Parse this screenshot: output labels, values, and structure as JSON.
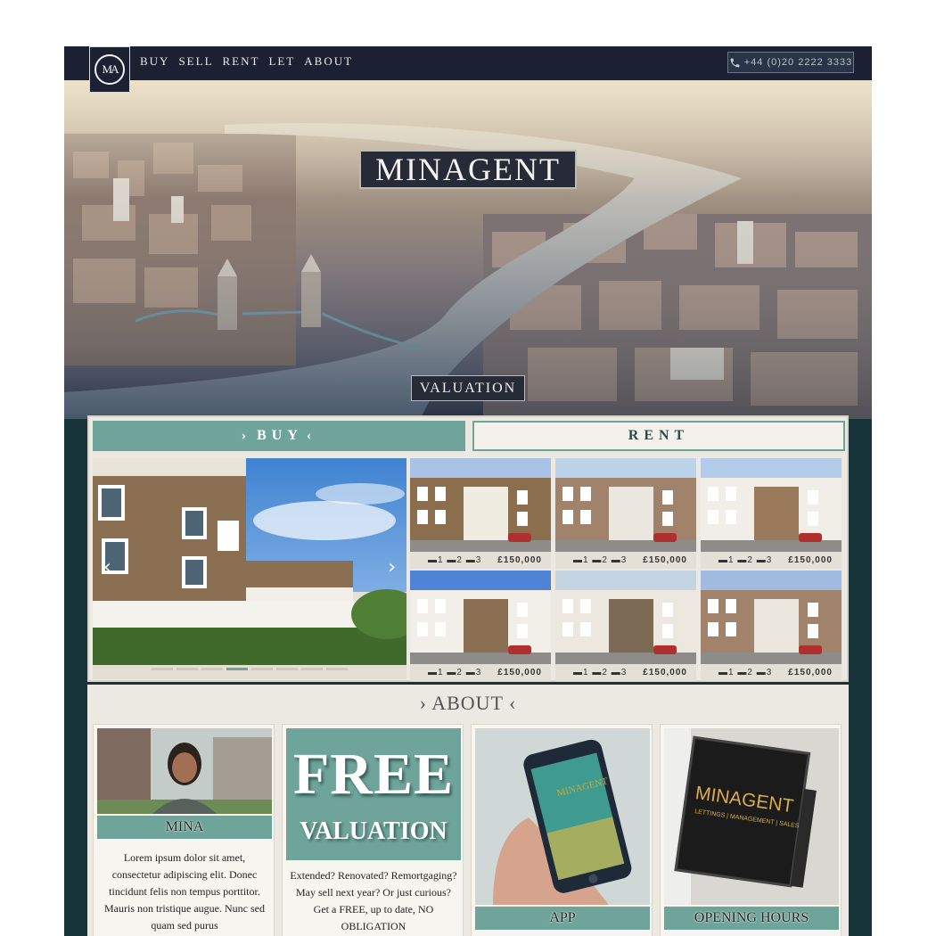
{
  "brand": {
    "logo_text": "MA",
    "title": "MINAGENT"
  },
  "nav": {
    "items": [
      "BUY",
      "SELL",
      "RENT",
      "LET",
      "ABOUT"
    ]
  },
  "phone": {
    "number": "+44 (0)20 2222 3333",
    "icon": "phone-icon"
  },
  "hero": {
    "valuation_label": "VALUATION"
  },
  "tabs": {
    "buy": "BUY",
    "rent": "RENT"
  },
  "slider": {
    "prev_icon": "chevron-left-icon",
    "next_icon": "chevron-right-icon",
    "dot_count": 8,
    "active_dot": 3
  },
  "listings": [
    {
      "beds": "1",
      "baths": "2",
      "receptions": "3",
      "price": "£150,000"
    },
    {
      "beds": "1",
      "baths": "2",
      "receptions": "3",
      "price": "£150,000"
    },
    {
      "beds": "1",
      "baths": "2",
      "receptions": "3",
      "price": "£150,000"
    },
    {
      "beds": "1",
      "baths": "2",
      "receptions": "3",
      "price": "£150,000"
    },
    {
      "beds": "1",
      "baths": "2",
      "receptions": "3",
      "price": "£150,000"
    },
    {
      "beds": "1",
      "baths": "2",
      "receptions": "3",
      "price": "£150,000"
    }
  ],
  "about": {
    "heading": "ABOUT",
    "mina": {
      "caption": "MINA",
      "text": "Lorem ipsum dolor sit amet, consectetur adipiscing elit. Donec tincidunt felis non tempus porttitor. Mauris non tristique augue. Nunc sed quam sed purus"
    },
    "valuation": {
      "big": "FREE",
      "small": "VALUATION",
      "text": "Extended? Renovated? Remortgaging? May sell next year? Or just curious? Get a FREE, up to date, NO OBLIGATION"
    },
    "app": {
      "caption": "APP",
      "screen_text": "MINAGENT"
    },
    "hours": {
      "caption": "OPENING HOURS",
      "sign_title": "MINAGENT",
      "sign_sub": "LETTINGS | MANAGEMENT | SALES"
    }
  },
  "colors": {
    "navy": "#1c2033",
    "teal": "#6fa49b",
    "dark_teal": "#17343a",
    "cream": "#ece9e2"
  }
}
